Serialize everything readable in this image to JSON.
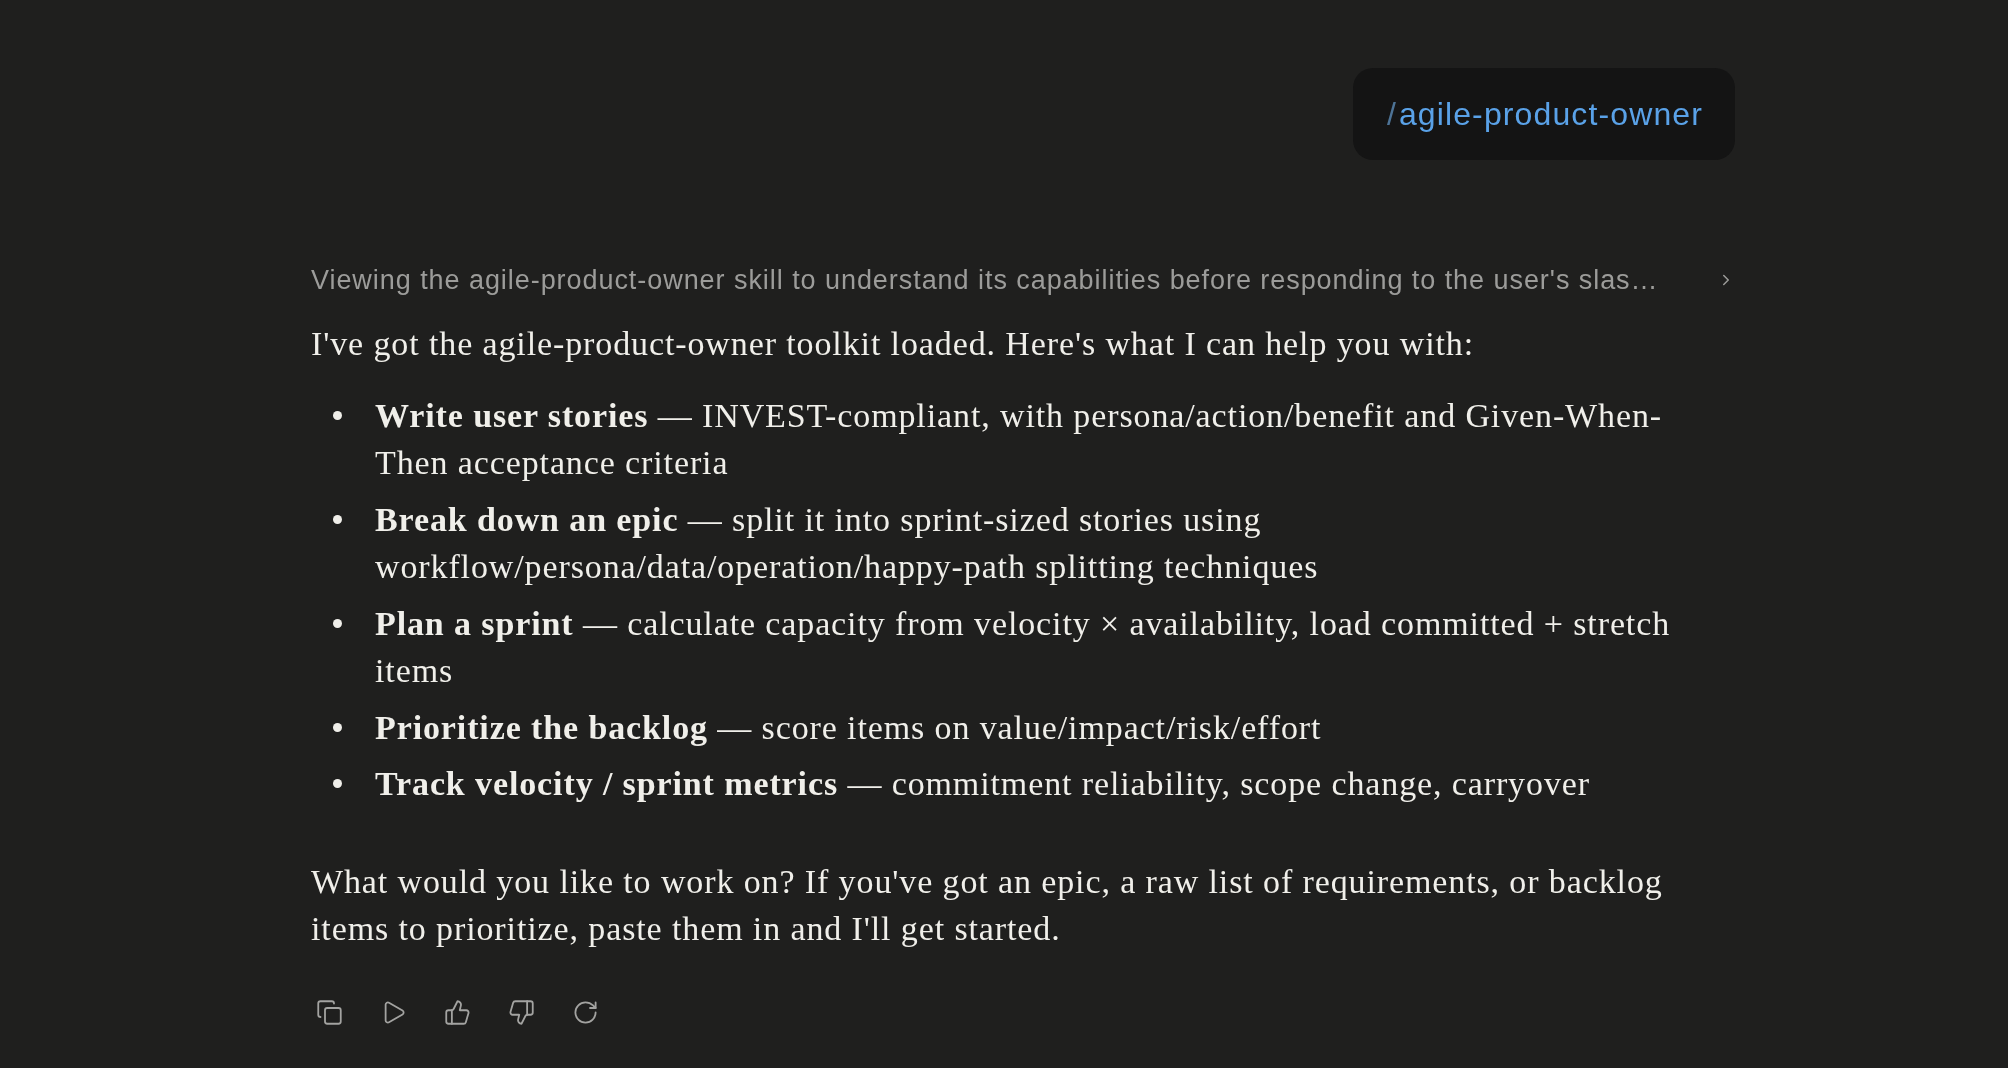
{
  "user_message": {
    "slash": "/",
    "command": "agile-product-owner"
  },
  "thinking_summary": {
    "text": "Viewing the agile-product-owner skill to understand its capabilities before responding to the user's slas…",
    "expanded": false
  },
  "response": {
    "intro": "I've got the agile-product-owner toolkit loaded. Here's what I can help you with:",
    "items": [
      "**Write user stories** — INVEST-compliant, with persona/action/benefit and Given-When-Then acceptance criteria",
      "**Break down an epic** — split it into sprint-sized stories using workflow/persona/data/operation/happy-path splitting techniques",
      "**Plan a sprint** — calculate capacity from velocity × availability, load committed + stretch items",
      "**Prioritize the backlog** — score items on value/impact/risk/effort",
      "**Track velocity / sprint metrics** — commitment reliability, scope change, carryover"
    ],
    "closing": "What would you like to work on? If you've got an epic, a raw list of requirements, or backlog items to prioritize, paste them in and I'll get started."
  }
}
